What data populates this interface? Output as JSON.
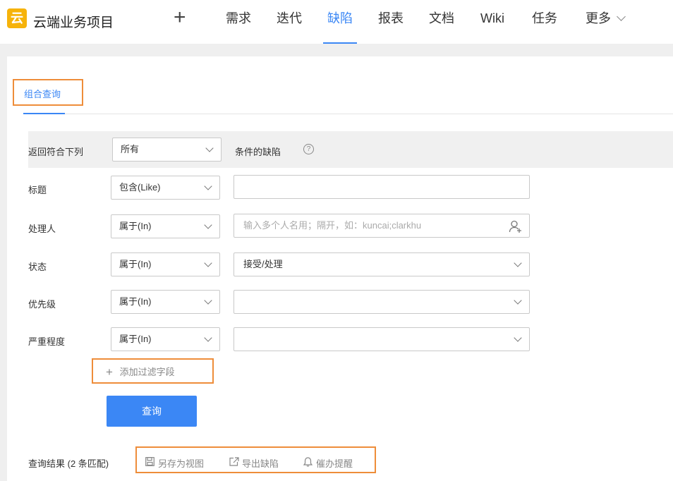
{
  "header": {
    "logo_char": "云",
    "project_name": "云端业务项目",
    "add_symbol": "+",
    "nav": [
      "需求",
      "迭代",
      "缺陷",
      "报表",
      "文档",
      "Wiki",
      "任务",
      "更多"
    ],
    "active_nav": "缺陷",
    "accent_color": "#3b87f5",
    "logo_color": "#f6b30b"
  },
  "tabs": {
    "combo_query": "组合查询"
  },
  "query": {
    "match_prefix": "返回符合下列",
    "match_value": "所有",
    "match_suffix": "条件的缺陷",
    "help_icon": "?",
    "rows": [
      {
        "label": "标题",
        "operator": "包含(Like)",
        "value": "",
        "placeholder": ""
      },
      {
        "label": "处理人",
        "operator": "属于(In)",
        "value": "",
        "placeholder": "输入多个人名用；隔开，如：kuncai;clarkhu"
      },
      {
        "label": "状态",
        "operator": "属于(In)",
        "value": "接受/处理",
        "placeholder": ""
      },
      {
        "label": "优先级",
        "operator": "属于(In)",
        "value": "",
        "placeholder": ""
      },
      {
        "label": "严重程度",
        "operator": "属于(In)",
        "value": "",
        "placeholder": ""
      }
    ],
    "add_filter": "添加过滤字段",
    "add_icon": "+",
    "submit": "查询"
  },
  "results": {
    "summary": "查询结果 (2 条匹配)",
    "actions": [
      {
        "icon": "save-icon",
        "label": "另存为视图"
      },
      {
        "icon": "export-icon",
        "label": "导出缺陷"
      },
      {
        "icon": "bell-icon",
        "label": "催办提醒"
      }
    ]
  },
  "highlight_color": "#ee8d3a"
}
